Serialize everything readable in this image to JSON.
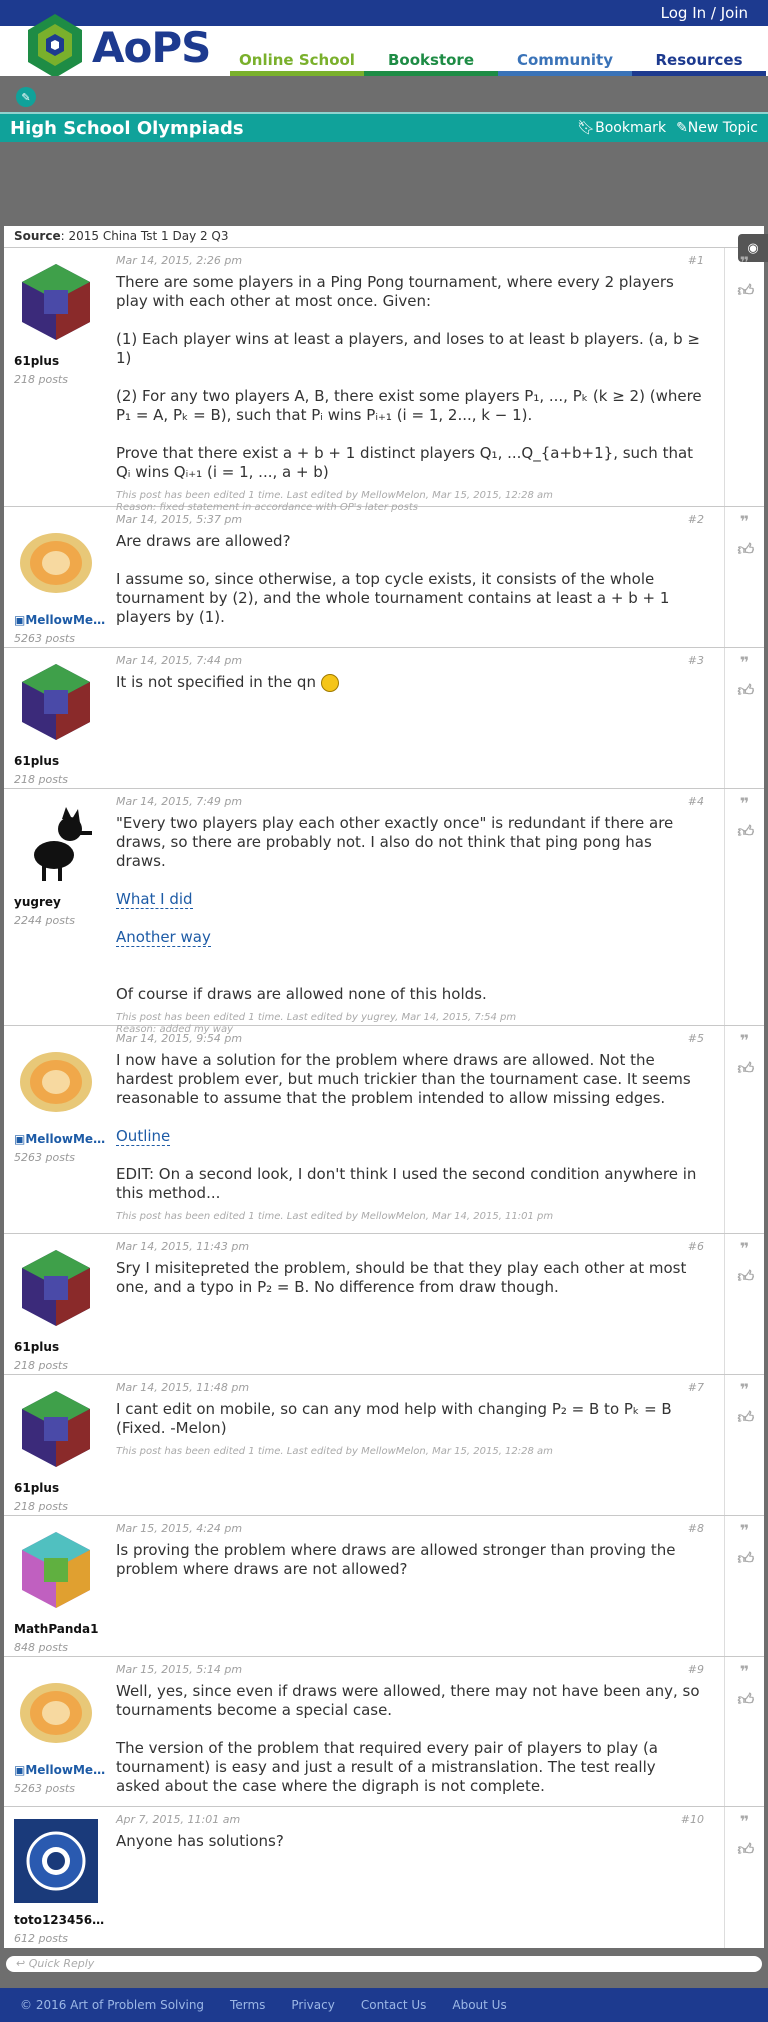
{
  "topbar": {
    "login": "Log In / Join"
  },
  "logo": {
    "text": "AoPS"
  },
  "nav": [
    {
      "label": "Online School",
      "color": "#7ab02c"
    },
    {
      "label": "Bookstore",
      "color": "#1e8c45"
    },
    {
      "label": "Community",
      "color": "#3a73b8"
    },
    {
      "label": "Resources",
      "color": "#1d3a8f"
    }
  ],
  "forum": {
    "title": "High School Olympiads",
    "bookmark": "Bookmark",
    "new_topic": "New Topic"
  },
  "thread": {
    "source_label": "Source",
    "source_value": ": 2015 China Tst 1 Day 2 Q3"
  },
  "posts": [
    {
      "user": "61plus",
      "posts": "218 posts",
      "date": "Mar 14, 2015, 2:26 pm",
      "num": "#1",
      "p1": "There are some players in a Ping Pong tournament, where every 2 players play with each other at most once. Given:",
      "p2": "(1) Each player wins at least a players, and loses to at least b players. (a, b ≥ 1)",
      "p3": "(2) For any two players A, B, there exist some players P₁, ..., Pₖ (k ≥ 2) (where P₁ = A, Pₖ = B), such that Pᵢ wins Pᵢ₊₁ (i = 1, 2..., k − 1).",
      "p4": "Prove that there exist a + b + 1 distinct players Q₁, ...Q_{a+b+1}, such that Qᵢ wins Qᵢ₊₁ (i = 1, ..., a + b)",
      "edit1": "This post has been edited 1 time. Last edited by MellowMelon, Mar 15, 2015, 12:28 am",
      "edit2": "Reason: fixed statement in accordance with OP's later posts"
    },
    {
      "user": "MellowMelon",
      "posts": "5263 posts",
      "date": "Mar 14, 2015, 5:37 pm",
      "num": "#2",
      "p1": "Are draws are allowed?",
      "p2": "I assume so, since otherwise, a top cycle exists, it consists of the whole tournament by (2), and the whole tournament contains at least a + b + 1 players by (1)."
    },
    {
      "user": "61plus",
      "posts": "218 posts",
      "date": "Mar 14, 2015, 7:44 pm",
      "num": "#3",
      "p1": "It is not specified in the qn"
    },
    {
      "user": "yugrey",
      "posts": "2244 posts",
      "date": "Mar 14, 2015, 7:49 pm",
      "num": "#4",
      "p1": "\"Every two players play each other exactly once\" is redundant if there are draws, so there are probably not. I also do not think that ping pong has draws.",
      "link1": "What I did",
      "link2": "Another way",
      "p2": "Of course if draws are allowed none of this holds.",
      "edit1": "This post has been edited 1 time. Last edited by yugrey, Mar 14, 2015, 7:54 pm",
      "edit2": "Reason: added my way"
    },
    {
      "user": "MellowMelon",
      "posts": "5263 posts",
      "date": "Mar 14, 2015, 9:54 pm",
      "num": "#5",
      "p1": "I now have a solution for the problem where draws are allowed. Not the hardest problem ever, but much trickier than the tournament case. It seems reasonable to assume that the problem intended to allow missing edges.",
      "link1": "Outline",
      "p2": "EDIT: On a second look, I don't think I used the second condition anywhere in this method...",
      "edit1": "This post has been edited 1 time. Last edited by MellowMelon, Mar 14, 2015, 11:01 pm"
    },
    {
      "user": "61plus",
      "posts": "218 posts",
      "date": "Mar 14, 2015, 11:43 pm",
      "num": "#6",
      "p1": "Sry I misitepreted the problem, should be that they play each other at most one, and a typo in P₂ = B. No difference from draw though."
    },
    {
      "user": "61plus",
      "posts": "218 posts",
      "date": "Mar 14, 2015, 11:48 pm",
      "num": "#7",
      "p1": "I cant edit on mobile, so can any mod help with changing P₂ = B to Pₖ = B (Fixed. -Melon)",
      "edit1": "This post has been edited 1 time. Last edited by MellowMelon, Mar 15, 2015, 12:28 am"
    },
    {
      "user": "MathPanda1",
      "posts": "848 posts",
      "date": "Mar 15, 2015, 4:24 pm",
      "num": "#8",
      "p1": "Is proving the problem where draws are allowed stronger than proving the problem where draws are not allowed?"
    },
    {
      "user": "MellowMelon",
      "posts": "5263 posts",
      "date": "Mar 15, 2015, 5:14 pm",
      "num": "#9",
      "p1": "Well, yes, since even if draws were allowed, there may not have been any, so tournaments become a special case.",
      "p2": "The version of the problem that required every pair of players to play (a tournament) is easy and just a result of a mistranslation. The test really asked about the case where the digraph is not complete."
    },
    {
      "user": "toto1234567...",
      "posts": "612 posts",
      "date": "Apr 7, 2015, 11:01 am",
      "num": "#10",
      "p1": "Anyone has solutions?"
    }
  ],
  "quick_reply": "Quick Reply",
  "footer": [
    "© 2016 Art of Problem Solving",
    "Terms",
    "Privacy",
    "Contact Us",
    "About Us"
  ]
}
